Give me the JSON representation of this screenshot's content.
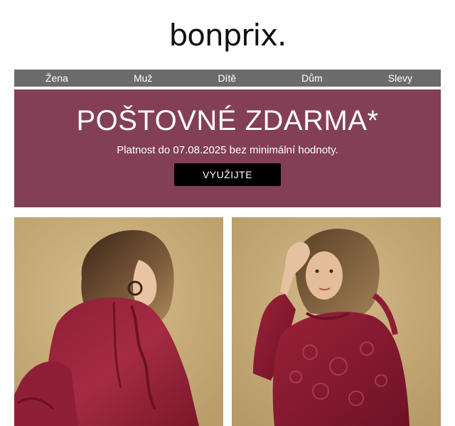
{
  "brand": {
    "logo_text": "bonprix."
  },
  "nav": {
    "items": [
      {
        "label": "Žena"
      },
      {
        "label": "Muž"
      },
      {
        "label": "Dítě"
      },
      {
        "label": "Dům"
      },
      {
        "label": "Slevy"
      }
    ]
  },
  "promo": {
    "title": "POŠTOVNÉ ZDARMA*",
    "subtitle": "Platnost do 07.08.2025 bez minimální hodnoty.",
    "cta_label": "VYUŽIJTE",
    "background_color": "#833f55",
    "button_color": "#000000"
  },
  "products": [
    {
      "image": "woman-burgundy-ruffle-blouse-photo"
    },
    {
      "image": "woman-burgundy-lace-dress-photo"
    }
  ]
}
